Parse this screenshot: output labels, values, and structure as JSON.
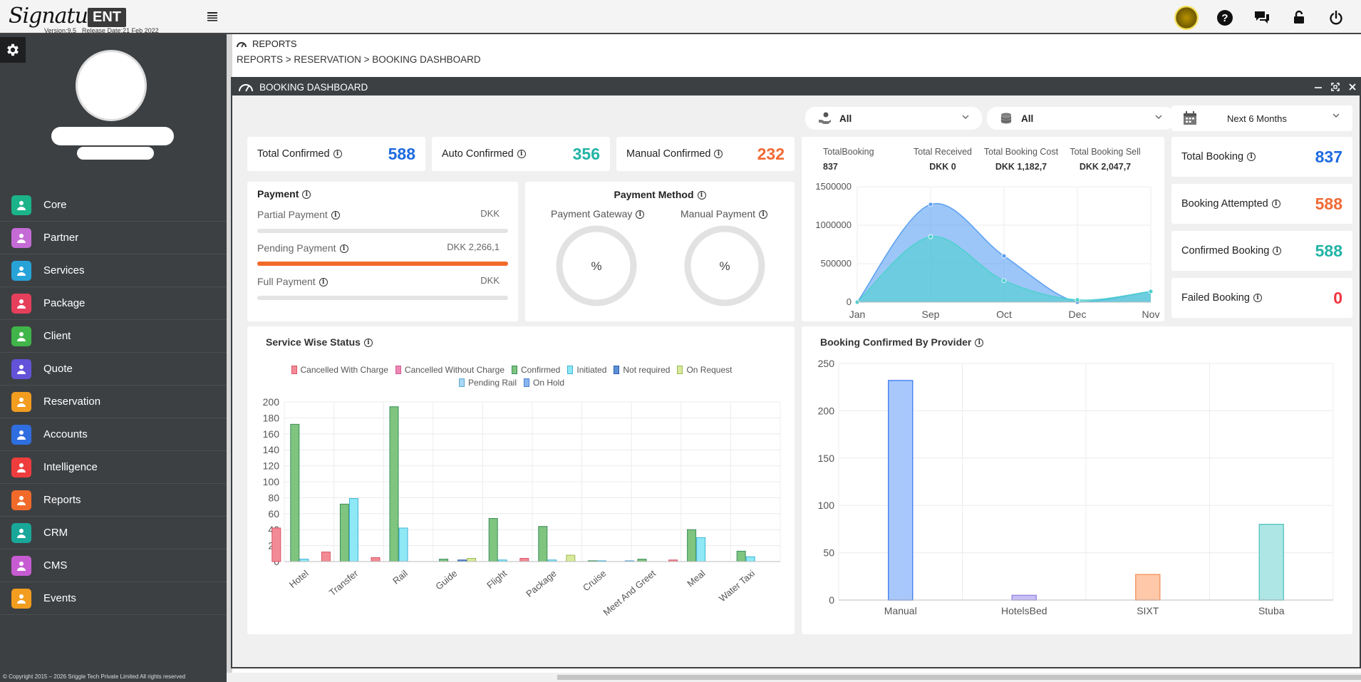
{
  "app": {
    "logo_script": "Signature",
    "logo_badge": "ENT",
    "version": "Version:9.5",
    "release": "Release Date:21 Feb 2022"
  },
  "topbar_icons": [
    "avatar-icon",
    "help-icon",
    "chat-icon",
    "unlock-icon",
    "power-icon"
  ],
  "sidebar": {
    "items": [
      {
        "label": "Core",
        "color": "#1bb38a",
        "icon": "core-icon"
      },
      {
        "label": "Partner",
        "color": "#c46bd6",
        "icon": "partner-icon"
      },
      {
        "label": "Services",
        "color": "#27a3d8",
        "icon": "services-icon"
      },
      {
        "label": "Package",
        "color": "#e63f5c",
        "icon": "package-icon"
      },
      {
        "label": "Client",
        "color": "#3fb54a",
        "icon": "client-icon"
      },
      {
        "label": "Quote",
        "color": "#6253d8",
        "icon": "quote-icon"
      },
      {
        "label": "Reservation",
        "color": "#f29d1f",
        "icon": "reservation-icon"
      },
      {
        "label": "Accounts",
        "color": "#2f6ee0",
        "icon": "accounts-icon"
      },
      {
        "label": "Intelligence",
        "color": "#ef3d3d",
        "icon": "intelligence-icon"
      },
      {
        "label": "Reports",
        "color": "#f26a2a",
        "icon": "reports-icon"
      },
      {
        "label": "CRM",
        "color": "#19a79a",
        "icon": "crm-icon"
      },
      {
        "label": "CMS",
        "color": "#c75cd2",
        "icon": "cms-icon"
      },
      {
        "label": "Events",
        "color": "#f29d1f",
        "icon": "events-icon"
      }
    ],
    "copyright": "© Copyright 2015 – 2026 Sriggle Tech Private Limited All rights reserved"
  },
  "breadcrumb": {
    "title": "REPORTS",
    "path": "REPORTS > RESERVATION > BOOKING DASHBOARD"
  },
  "panel": {
    "title": "BOOKING DASHBOARD"
  },
  "filters": {
    "service": "All",
    "provider": "All",
    "period": "Next 6 Months"
  },
  "kpis": {
    "total_confirmed": {
      "label": "Total Confirmed",
      "value": "588"
    },
    "auto_confirmed": {
      "label": "Auto Confirmed",
      "value": "356"
    },
    "manual_confirmed": {
      "label": "Manual Confirmed",
      "value": "232"
    }
  },
  "payment": {
    "title": "Payment",
    "partial": {
      "label": "Partial Payment",
      "value": "DKK",
      "fill": 0
    },
    "pending": {
      "label": "Pending Payment",
      "value": "DKK 2,266,1",
      "fill": 1
    },
    "full": {
      "label": "Full Payment",
      "value": "DKK",
      "fill": 0
    }
  },
  "payment_method": {
    "title": "Payment Method",
    "gateway": {
      "label": "Payment Gateway",
      "value": "%"
    },
    "manual": {
      "label": "Manual Payment",
      "value": "%"
    }
  },
  "summary": {
    "total_booking": {
      "label": "TotalBooking",
      "value": "837"
    },
    "total_received": {
      "label": "Total Received",
      "value": "DKK 0"
    },
    "total_cost": {
      "label": "Total Booking Cost",
      "value": "DKK 1,182,7"
    },
    "total_sell": {
      "label": "Total Booking Sell",
      "value": "DKK 2,047,7"
    }
  },
  "right_kpis": {
    "total_booking": {
      "label": "Total Booking",
      "value": "837"
    },
    "attempted": {
      "label": "Booking Attempted",
      "value": "588"
    },
    "confirmed": {
      "label": "Confirmed Booking",
      "value": "588"
    },
    "failed": {
      "label": "Failed Booking",
      "value": "0"
    }
  },
  "service_chart_title": "Service Wise Status",
  "provider_chart_title": "Booking Confirmed By Provider",
  "chart_data": [
    {
      "type": "area",
      "categories": [
        "Jan",
        "Sep",
        "Oct",
        "Dec",
        "Nov"
      ],
      "ylim": [
        0,
        1500000
      ],
      "yticks": [
        "0",
        "500000",
        "1000000",
        "1500000"
      ],
      "series": [
        {
          "values": [
            0,
            1270000,
            600000,
            0,
            140000
          ],
          "color": "#5aa0f2"
        },
        {
          "values": [
            0,
            850000,
            280000,
            30000,
            140000
          ],
          "color": "#4fd0cf"
        }
      ],
      "grid": true,
      "legend": "none"
    },
    {
      "type": "bar",
      "categories": [
        "Hotel",
        "Transfer",
        "Rail",
        "Guide",
        "Flight",
        "Package",
        "Cruise",
        "Meet And Greet",
        "Meal",
        "Water Taxi"
      ],
      "ylim": [
        0,
        200
      ],
      "yticks": [
        "0",
        "20",
        "40",
        "60",
        "80",
        "100",
        "120",
        "140",
        "160",
        "180",
        "200"
      ],
      "legend": "top",
      "series": [
        {
          "name": "Cancelled With Charge",
          "color": "#f28b95",
          "stroke": "#d9546a",
          "values": [
            42,
            12,
            5,
            0,
            0,
            4,
            0,
            0,
            2,
            0
          ]
        },
        {
          "name": "Cancelled Without Charge",
          "color": "#ee87b4",
          "stroke": "#cf5d94",
          "values": [
            0,
            0,
            0,
            0,
            0,
            0,
            0,
            0,
            0,
            0
          ]
        },
        {
          "name": "Confirmed",
          "color": "#7fc47f",
          "stroke": "#3a8f5a",
          "values": [
            172,
            72,
            194,
            3,
            54,
            44,
            1,
            3,
            40,
            13
          ]
        },
        {
          "name": "Initiated",
          "color": "#8ee8f5",
          "stroke": "#3fb3d6",
          "values": [
            3,
            79,
            42,
            0,
            2,
            2,
            1,
            0,
            30,
            6
          ]
        },
        {
          "name": "Not required",
          "color": "#5c8fd6",
          "stroke": "#2f5fab",
          "values": [
            0,
            0,
            0,
            2,
            0,
            0,
            0,
            0,
            0,
            0
          ]
        },
        {
          "name": "On Request",
          "color": "#d6ea9a",
          "stroke": "#9fb85a",
          "values": [
            0,
            0,
            0,
            4,
            0,
            8,
            0,
            0,
            0,
            0
          ]
        },
        {
          "name": "Pending Rail",
          "color": "#a7d7f2",
          "stroke": "#5ea7d6",
          "values": [
            0,
            0,
            0,
            0,
            0,
            0,
            1,
            0,
            0,
            0
          ]
        },
        {
          "name": "On Hold",
          "color": "#8ab6f0",
          "stroke": "#4a80cf",
          "values": [
            0,
            0,
            0,
            0,
            0,
            0,
            0,
            0,
            0,
            0
          ]
        }
      ],
      "grid": true
    },
    {
      "type": "bar",
      "categories": [
        "Manual",
        "HotelsBed",
        "SIXT",
        "Stuba"
      ],
      "values": [
        232,
        5,
        27,
        80
      ],
      "colors": [
        "#a8c8fc",
        "#c8bff5",
        "#ffc8a8",
        "#aee6e6"
      ],
      "strokes": [
        "#4b86f0",
        "#9a8ee8",
        "#f59a6a",
        "#60c9c2"
      ],
      "ylim": [
        0,
        250
      ],
      "yticks": [
        "0",
        "50",
        "100",
        "150",
        "200",
        "250"
      ],
      "grid": true,
      "legend": "none"
    }
  ]
}
